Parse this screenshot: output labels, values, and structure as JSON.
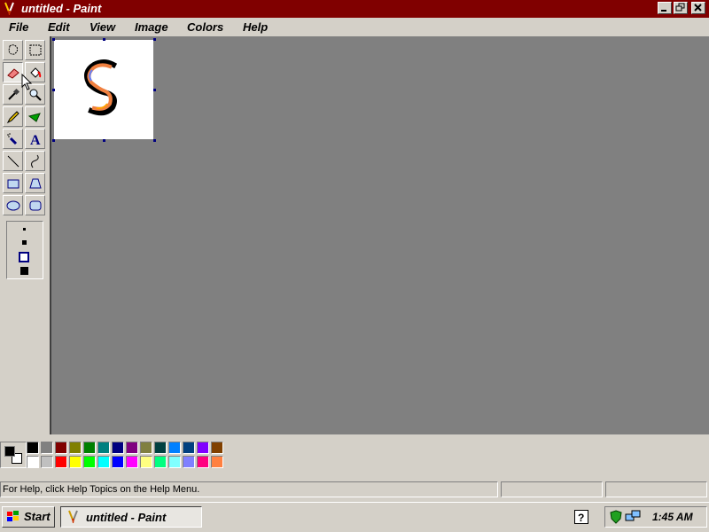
{
  "window": {
    "title": "untitled - Paint",
    "controls": {
      "minimize": "minimize-button",
      "restore": "restore-button",
      "close": "close-button"
    }
  },
  "menu": {
    "items": [
      "File",
      "Edit",
      "View",
      "Image",
      "Colors",
      "Help"
    ]
  },
  "toolbox": {
    "tools": [
      {
        "name": "free-form-select",
        "icon": "free-select-icon"
      },
      {
        "name": "rectangle-select",
        "icon": "rect-select-icon"
      },
      {
        "name": "eraser",
        "icon": "eraser-icon",
        "active": true
      },
      {
        "name": "fill-with-color",
        "icon": "fill-bucket-icon"
      },
      {
        "name": "pick-color",
        "icon": "eyedropper-icon"
      },
      {
        "name": "magnifier",
        "icon": "magnifier-icon"
      },
      {
        "name": "pencil",
        "icon": "pencil-icon"
      },
      {
        "name": "brush",
        "icon": "brush-icon"
      },
      {
        "name": "airbrush",
        "icon": "airbrush-icon"
      },
      {
        "name": "text",
        "icon": "text-icon",
        "glyph": "A"
      },
      {
        "name": "line",
        "icon": "line-icon"
      },
      {
        "name": "curve",
        "icon": "curve-icon"
      },
      {
        "name": "rectangle",
        "icon": "rectangle-icon"
      },
      {
        "name": "polygon",
        "icon": "polygon-icon"
      },
      {
        "name": "ellipse",
        "icon": "ellipse-icon"
      },
      {
        "name": "rounded-rectangle",
        "icon": "rounded-rect-icon"
      }
    ]
  },
  "palette": {
    "foreground": "#000000",
    "background": "#ffffff",
    "colors_top": [
      "#000000",
      "#808080",
      "#800000",
      "#808000",
      "#008000",
      "#008080",
      "#000080",
      "#800080",
      "#808040",
      "#004040",
      "#0080ff",
      "#004080",
      "#8000ff",
      "#804000"
    ],
    "colors_bottom": [
      "#ffffff",
      "#c0c0c0",
      "#ff0000",
      "#ffff00",
      "#00ff00",
      "#00ffff",
      "#0000ff",
      "#ff00ff",
      "#ffff80",
      "#00ff80",
      "#80ffff",
      "#8080ff",
      "#ff0080",
      "#ff8040"
    ]
  },
  "status": {
    "help_text": "For Help, click Help Topics on the Help Menu.",
    "pane2": "",
    "pane3": ""
  },
  "taskbar": {
    "start_label": "Start",
    "task_label": "untitled - Paint",
    "clock": "1:45 AM"
  }
}
